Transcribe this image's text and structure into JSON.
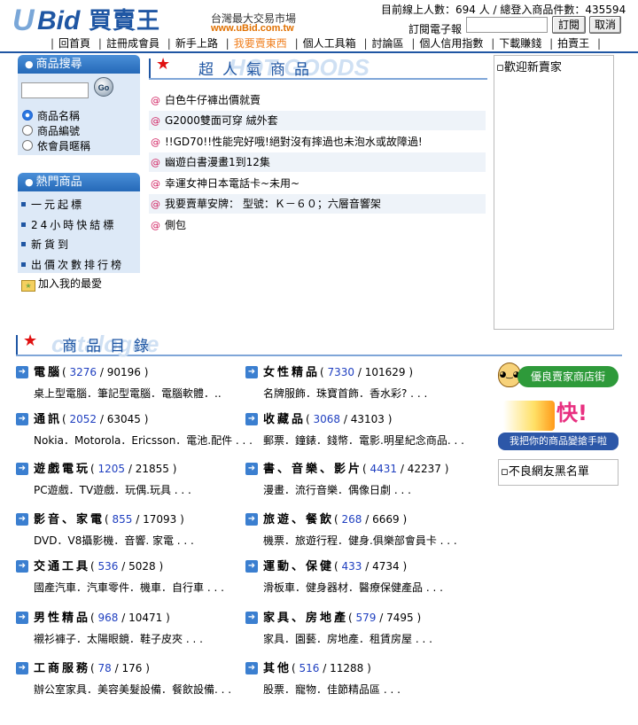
{
  "header": {
    "logo_u": "U",
    "logo_bid": "Bid",
    "logo_cn": "買賣王",
    "tagline": "台灣最大交易市場",
    "url": "www.uBid.com.tw",
    "online_text": "目前線上人數：694 人 / 總登入商品件數：435594",
    "subscribe_label": "訂閱電子報",
    "subscribe_button": "訂閱",
    "cancel_button": "取消"
  },
  "nav": {
    "items": [
      {
        "label": "回首頁"
      },
      {
        "label": "註冊成會員"
      },
      {
        "label": "新手上路"
      },
      {
        "label": "我要賣東西"
      },
      {
        "label": "個人工具箱"
      },
      {
        "label": "討論區"
      },
      {
        "label": "個人信用指數"
      },
      {
        "label": "下載賺錢"
      },
      {
        "label": "拍賣王"
      }
    ],
    "highlight_color": "#f08020"
  },
  "sidebar": {
    "search_title": "商品搜尋",
    "go_label": "Go",
    "radios": [
      {
        "label": "商品名稱",
        "checked": true
      },
      {
        "label": "商品編號",
        "checked": false
      },
      {
        "label": "依會員暱稱",
        "checked": false
      }
    ],
    "hot_title": "熱門商品",
    "hot_items": [
      "一元起標",
      "24小時快結標",
      "新貨到",
      "出價次數排行榜"
    ],
    "favorite": "加入我的最愛"
  },
  "popular": {
    "title": "超人氣商品",
    "bg_text": "HOT GOODS",
    "items": [
      "白色牛仔褲出價就賣",
      "G2000雙面可穿 絨外套",
      "!!GD70!!性能完好哦!絕對沒有摔過也未泡水或故障過!",
      "幽遊白書漫畫1到12集",
      "幸運女神日本電話卡~未用~",
      "我要賣華安牌： 型號：Ｋ－６０；六層音響架",
      "側包"
    ]
  },
  "right": {
    "welcome_alt": "歡迎新賣家",
    "good_seller": "優良賣家商店街",
    "quick_big": "快!",
    "quick_caption": "我把你的商品變搶手啦",
    "blacklist_alt": "不良網友黑名單"
  },
  "catalog": {
    "title": "商品目錄",
    "bg_text": "catalogue",
    "categories": [
      {
        "name": "電腦",
        "n1": "3276",
        "n2": "90196",
        "desc": "桌上型電腦．筆記型電腦．電腦軟體．.."
      },
      {
        "name": "女性精品",
        "n1": "7330",
        "n2": "101629",
        "desc": "名牌服飾．珠寶首飾．香水彩? . . ."
      },
      {
        "name": "通訊",
        "n1": "2052",
        "n2": "63045",
        "desc": "Nokia．Motorola．Ericsson．電池.配件 . . ."
      },
      {
        "name": "收藏品",
        "n1": "3068",
        "n2": "43103",
        "desc": "郵票．鐘錶．錢幣．電影.明星紀念商品. . ."
      },
      {
        "name": "遊戲電玩",
        "n1": "1205",
        "n2": "21855",
        "desc": "PC遊戲．TV遊戲．玩偶.玩具 . . ."
      },
      {
        "name": "書、音樂、影片",
        "n1": "4431",
        "n2": "42237",
        "desc": "漫畫．流行音樂．偶像日劇 . . ."
      },
      {
        "name": "影音、家電",
        "n1": "855",
        "n2": "17093",
        "desc": "DVD．V8攝影機．音響. 家電 . . ."
      },
      {
        "name": "旅遊、餐飲",
        "n1": "268",
        "n2": "6669",
        "desc": "機票．旅遊行程．健身.俱樂部會員卡 . . ."
      },
      {
        "name": "交通工具",
        "n1": "536",
        "n2": "5028",
        "desc": "國產汽車．汽車零件．機車．自行車 . . ."
      },
      {
        "name": "運動、保健",
        "n1": "433",
        "n2": "4734",
        "desc": "滑板車．健身器材．醫療保健產品 . . ."
      },
      {
        "name": "男性精品",
        "n1": "968",
        "n2": "10471",
        "desc": "襯衫褲子．太陽眼鏡．鞋子皮夾 . . ."
      },
      {
        "name": "家具、房地產",
        "n1": "579",
        "n2": "7495",
        "desc": "家具．園藝．房地產．租賃房屋 . . ."
      },
      {
        "name": "工商服務",
        "n1": "78",
        "n2": "176",
        "desc": "辦公室家具．美容美髮設備．餐飲設備. . ."
      },
      {
        "name": "其他",
        "n1": "516",
        "n2": "11288",
        "desc": "股票．寵物．佳節精品區 . . ."
      }
    ]
  }
}
